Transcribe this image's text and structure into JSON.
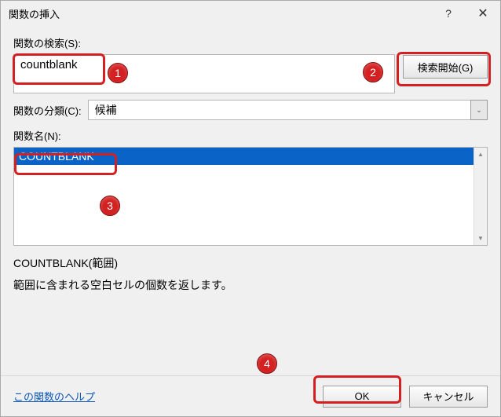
{
  "titlebar": {
    "title": "関数の挿入",
    "help_glyph": "?",
    "close_glyph": "✕"
  },
  "search": {
    "label": "関数の検索(S):",
    "value": "countblank"
  },
  "go_button": {
    "label": "検索開始(G)"
  },
  "category": {
    "label": "関数の分類(C):",
    "selected": "候補",
    "arrow_glyph": "⌄"
  },
  "list": {
    "label": "関数名(N):",
    "items": [
      {
        "name": "COUNTBLANK",
        "selected": true
      }
    ],
    "scroll_up_glyph": "▲",
    "scroll_down_glyph": "▼"
  },
  "syntax": "COUNTBLANK(範囲)",
  "description": "範囲に含まれる空白セルの個数を返します。",
  "footer": {
    "help_link": "この関数のヘルプ",
    "ok": "OK",
    "cancel": "キャンセル"
  },
  "annotations": {
    "b1": "1",
    "b2": "2",
    "b3": "3",
    "b4": "4"
  }
}
